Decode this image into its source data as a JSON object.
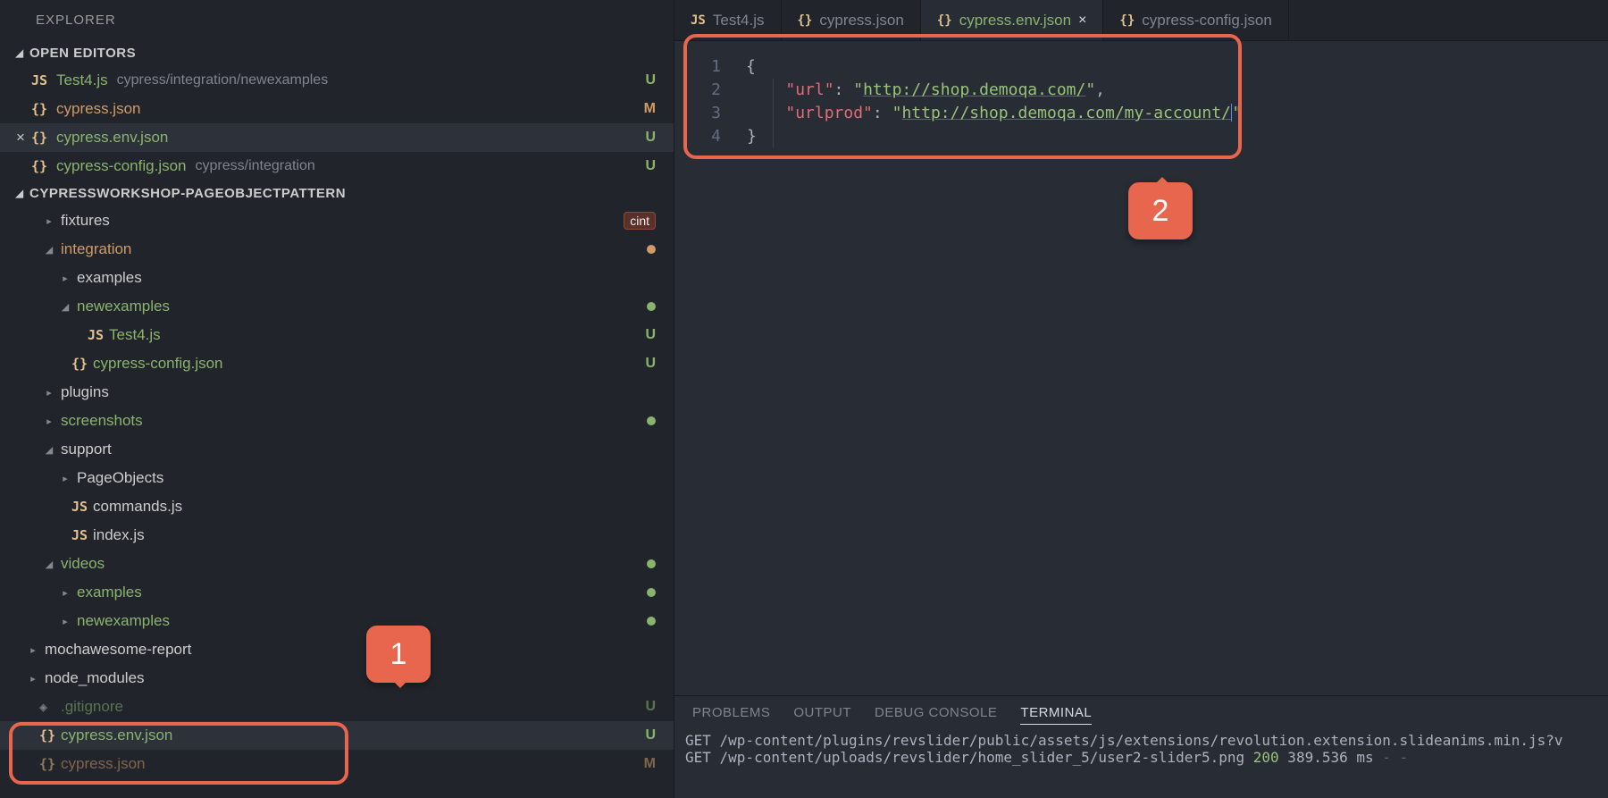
{
  "sidebar": {
    "title": "EXPLORER",
    "open_editors_header": "OPEN EDITORS",
    "open_editors": [
      {
        "icon": "JS",
        "iconClass": "js",
        "name": "Test4.js",
        "desc": "cypress/integration/newexamples",
        "git": "U",
        "close": ""
      },
      {
        "icon": "{}",
        "iconClass": "json",
        "name": "cypress.json",
        "desc": "",
        "git": "M",
        "close": ""
      },
      {
        "icon": "{}",
        "iconClass": "json",
        "name": "cypress.env.json",
        "desc": "",
        "git": "U",
        "close": "×",
        "selected": true
      },
      {
        "icon": "{}",
        "iconClass": "json",
        "name": "cypress-config.json",
        "desc": "cypress/integration",
        "git": "U",
        "close": ""
      }
    ],
    "project_header": "CYPRESSWORKSHOP-PAGEOBJECTPATTERN",
    "cint_badge": "cint",
    "tree": [
      {
        "depth": 1,
        "twisty": "▸",
        "icon": "",
        "name": "fixtures",
        "git": "",
        "dot": "",
        "light": true
      },
      {
        "depth": 1,
        "twisty": "◢",
        "icon": "",
        "name": "integration",
        "git": "",
        "dot": "orange"
      },
      {
        "depth": 2,
        "twisty": "▸",
        "icon": "",
        "name": "examples",
        "git": "",
        "dot": "",
        "light": true
      },
      {
        "depth": 2,
        "twisty": "◢",
        "icon": "",
        "name": "newexamples",
        "git": "",
        "dot": "green"
      },
      {
        "depth": 3,
        "twisty": "",
        "icon": "JS",
        "iconClass": "js",
        "name": "Test4.js",
        "git": "U"
      },
      {
        "depth": 2,
        "twisty": "",
        "icon": "{}",
        "iconClass": "json",
        "name": "cypress-config.json",
        "git": "U"
      },
      {
        "depth": 1,
        "twisty": "▸",
        "icon": "",
        "name": "plugins",
        "git": "",
        "light": true
      },
      {
        "depth": 1,
        "twisty": "▸",
        "icon": "",
        "name": "screenshots",
        "git": "",
        "dot": "green"
      },
      {
        "depth": 1,
        "twisty": "◢",
        "icon": "",
        "name": "support",
        "git": "",
        "light": true
      },
      {
        "depth": 2,
        "twisty": "▸",
        "icon": "",
        "name": "PageObjects",
        "git": "",
        "light": true
      },
      {
        "depth": 2,
        "twisty": "",
        "icon": "JS",
        "iconClass": "js",
        "name": "commands.js",
        "git": "",
        "light": true
      },
      {
        "depth": 2,
        "twisty": "",
        "icon": "JS",
        "iconClass": "js",
        "name": "index.js",
        "git": "",
        "light": true
      },
      {
        "depth": 1,
        "twisty": "◢",
        "icon": "",
        "name": "videos",
        "git": "",
        "dot": "green"
      },
      {
        "depth": 2,
        "twisty": "▸",
        "icon": "",
        "name": "examples",
        "git": "",
        "dot": "green"
      },
      {
        "depth": 2,
        "twisty": "▸",
        "icon": "",
        "name": "newexamples",
        "git": "",
        "dot": "green"
      },
      {
        "depth": 0,
        "twisty": "▸",
        "icon": "",
        "name": "mochawesome-report",
        "git": "",
        "light": true
      },
      {
        "depth": 0,
        "twisty": "▸",
        "icon": "",
        "name": "node_modules",
        "git": "",
        "light": true
      },
      {
        "depth": 0,
        "twisty": "",
        "icon": "◈",
        "name": ".gitignore",
        "git": "U",
        "dim": true
      },
      {
        "depth": 0,
        "twisty": "",
        "icon": "{}",
        "iconClass": "json",
        "name": "cypress.env.json",
        "git": "U",
        "selected": true
      },
      {
        "depth": 0,
        "twisty": "",
        "icon": "{}",
        "iconClass": "json",
        "name": "cypress.json",
        "git": "M",
        "dim": true
      }
    ]
  },
  "tabs": [
    {
      "icon": "JS",
      "iconClass": "js",
      "label": "Test4.js",
      "git": "",
      "active": false
    },
    {
      "icon": "{}",
      "iconClass": "json",
      "label": "cypress.json",
      "git": "",
      "active": false
    },
    {
      "icon": "{}",
      "iconClass": "json",
      "label": "cypress.env.json",
      "git": "U",
      "active": true,
      "close": "×"
    },
    {
      "icon": "{}",
      "iconClass": "json",
      "label": "cypress-config.json",
      "git": "",
      "active": false
    }
  ],
  "editor": {
    "lines": [
      {
        "n": "1",
        "html": "<span class='punct'>{</span>"
      },
      {
        "n": "2",
        "guide": true,
        "html": "    <span class='key'>\"url\"</span><span class='punct'>: </span><span class='str'>\"</span><span class='str url'>http://shop.demoqa.com/</span><span class='str'>\"</span><span class='punct'>,</span>"
      },
      {
        "n": "3",
        "guide": true,
        "html": "    <span class='key'>\"urlprod\"</span><span class='punct'>: </span><span class='str'>\"</span><span class='str url'>http://shop.demoqa.com/my-account/</span><span class='cursor-caret'></span><span class='str'>\"</span>"
      },
      {
        "n": "4",
        "guide": true,
        "html": "<span class='punct'>}</span>"
      }
    ]
  },
  "panel": {
    "tabs": [
      "PROBLEMS",
      "OUTPUT",
      "DEBUG CONSOLE",
      "TERMINAL"
    ],
    "active": "TERMINAL",
    "lines": [
      "GET /wp-content/plugins/revslider/public/assets/js/extensions/revolution.extension.slideanims.min.js?v",
      "GET /wp-content/uploads/revslider/home_slider_5/user2-slider5.png <span class='t-green'>200</span> 389.536 ms <span class='t-dim'>- -</span>"
    ]
  },
  "annotations": {
    "one": "1",
    "two": "2"
  },
  "colors": {
    "accent": "#e8664e",
    "bg": "#282c34"
  }
}
